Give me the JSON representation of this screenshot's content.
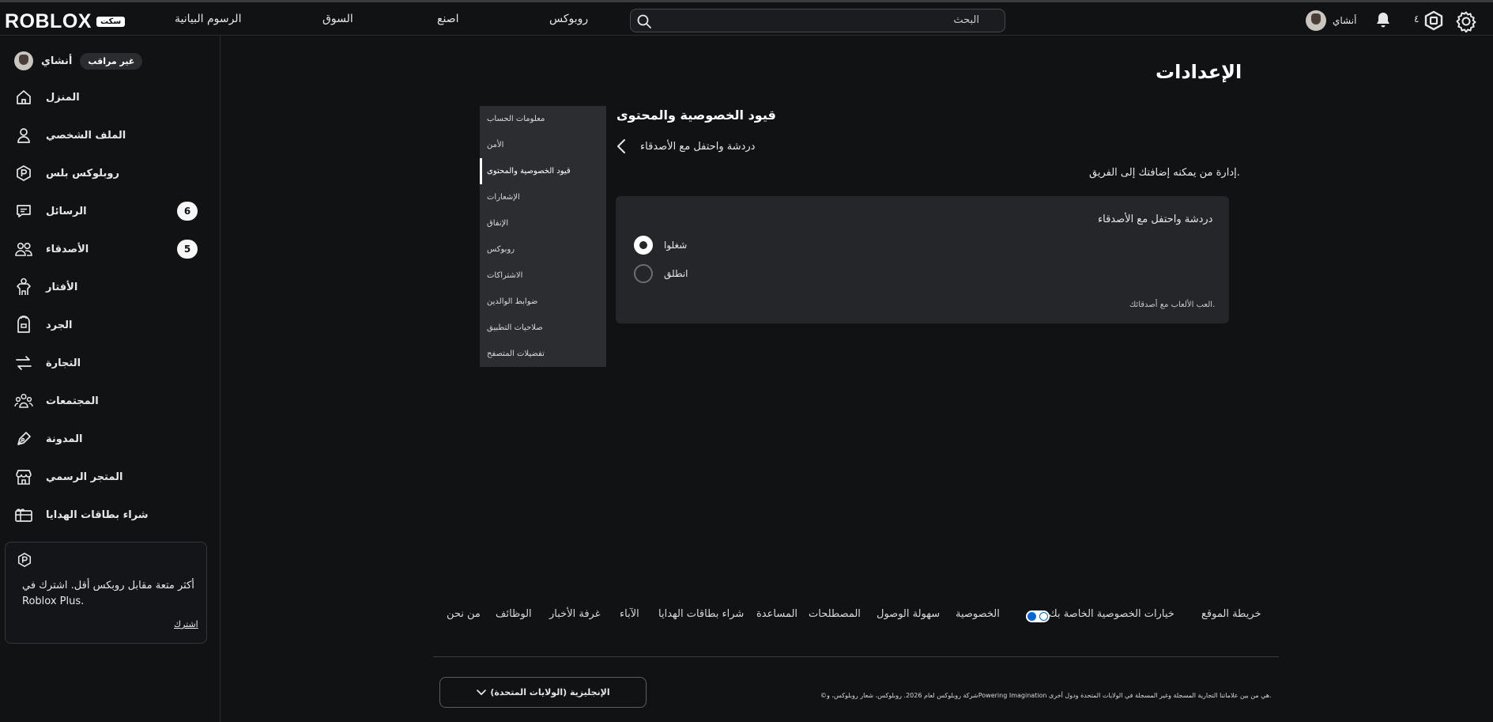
{
  "topbar": {
    "logo_text": "ROBLOX",
    "logo_badge": "سكت",
    "nav": [
      "الرسوم البيانية",
      "السوق",
      "اصنع",
      "روبوكس"
    ],
    "search_placeholder": "البحث",
    "username": "أنشاي",
    "robux_count": "٤"
  },
  "sidebar": {
    "username": "أنشاي",
    "unverified_badge": "غير مراقب",
    "items": [
      {
        "label": "المنزل",
        "icon": "home-icon"
      },
      {
        "label": "الملف الشخصي",
        "icon": "profile-icon"
      },
      {
        "label": "روبلوكس بلس",
        "icon": "roblox-plus-icon"
      },
      {
        "label": "الرسائل",
        "icon": "messages-icon",
        "count": "6"
      },
      {
        "label": "الأصدقاء",
        "icon": "friends-icon",
        "count": "5"
      },
      {
        "label": "الأفتار",
        "icon": "avatar-icon"
      },
      {
        "label": "الجرد",
        "icon": "inventory-icon"
      },
      {
        "label": "التجارة",
        "icon": "trade-icon"
      },
      {
        "label": "المجتمعات",
        "icon": "communities-icon"
      },
      {
        "label": "المدونة",
        "icon": "blog-icon"
      },
      {
        "label": "المتجر الرسمي",
        "icon": "store-icon"
      },
      {
        "label": "شراء بطاقات الهدايا",
        "icon": "gift-card-icon"
      }
    ],
    "promo": {
      "text": "أكثر متعة مقابل روبكس أقل. اشترك في Roblox Plus.",
      "link": "اشترك"
    }
  },
  "main": {
    "page_title": "الإعدادات",
    "menu": [
      "معلومات الحساب",
      "الأمن",
      "قيود الخصوصية والمحتوى",
      "الإشعارات",
      "الإنفاق",
      "روبوكس",
      "الاشتراكات",
      "ضوابط الوالدين",
      "صلاحيات التطبيق",
      "تفضيلات المتصفح"
    ],
    "active_menu_index": 2,
    "section_title": "قيود الخصوصية والمحتوى",
    "breadcrumb": "دردشة واحتفل مع الأصدقاء",
    "description": "إدارة من يمكنه إضافتك إلى الفريق.",
    "card": {
      "title": "دردشة واحتفل مع الأصدقاء",
      "options": [
        {
          "label": "شغلوا",
          "checked": true
        },
        {
          "label": "انطلق",
          "checked": false
        }
      ],
      "note": "العب الألعاب مع أصدقائك."
    }
  },
  "footer": {
    "links": [
      "خريطة الموقع",
      "خيارات الخصوصية الخاصة بك",
      "الخصوصية",
      "سهولة الوصول",
      "المصطلحات",
      "المساعدة",
      "شراء بطاقات الهدايا",
      "الآباء",
      "غرفة الأخبار",
      "الوظائف",
      "من نحن"
    ],
    "language": "الإنجليزية (الولايات المتحدة)",
    "copyright": "©شركة روبلوكس لعام 2026. روبلوكس، شعار روبلوكس، وPowering Imagination هي من بين علاماتنا التجارية المسجلة وغير المسجلة في الولايات المتحدة ودول أخرى."
  }
}
